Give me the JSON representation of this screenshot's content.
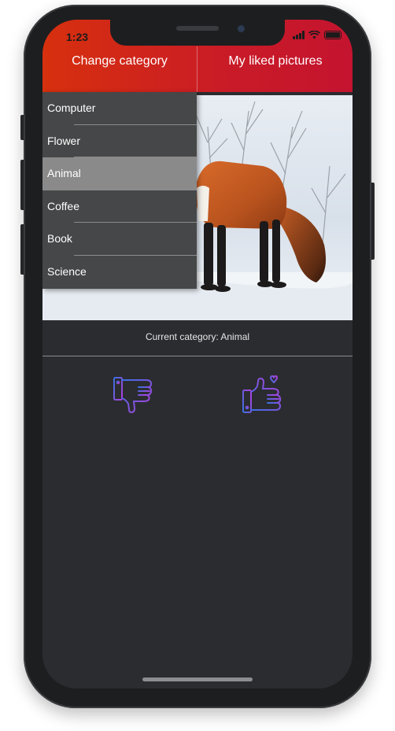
{
  "status_bar": {
    "time": "1:23"
  },
  "tabs": {
    "change_category": "Change category",
    "liked_pictures": "My liked pictures"
  },
  "categories": [
    {
      "label": "Computer",
      "selected": false
    },
    {
      "label": "Flower",
      "selected": false
    },
    {
      "label": "Animal",
      "selected": true
    },
    {
      "label": "Coffee",
      "selected": false
    },
    {
      "label": "Book",
      "selected": false
    },
    {
      "label": "Science",
      "selected": false
    }
  ],
  "current_category_text": "Current category: Animal",
  "actions": {
    "dislike_icon": "thumbs-down-icon",
    "like_icon": "thumbs-up-heart-icon"
  },
  "colors": {
    "header_start": "#d7300e",
    "header_end": "#c4142f",
    "screen_bg": "#2b2c30",
    "dropdown_bg": "#464748",
    "selected_item_bg": "#8a8a8a",
    "icon_gradient_start": "#3b6fe0",
    "icon_gradient_end": "#b43fdc"
  }
}
